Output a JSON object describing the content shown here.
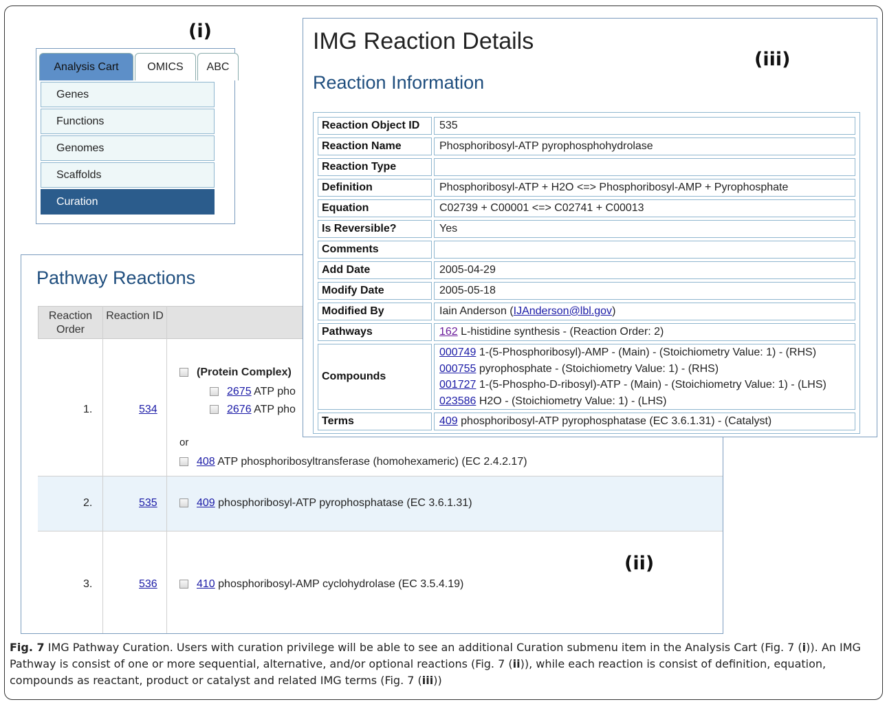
{
  "panel_labels": {
    "i": "(i)",
    "ii": "(ii)",
    "iii": "(iii)"
  },
  "menu": {
    "tabs": [
      "Analysis Cart",
      "OMICS",
      "ABC"
    ],
    "items": [
      "Genes",
      "Functions",
      "Genomes",
      "Scaffolds",
      "Curation"
    ],
    "active_item": "Curation"
  },
  "pathway": {
    "title": "Pathway Reactions",
    "headers": {
      "order": "Reaction Order",
      "id": "Reaction ID"
    },
    "rows": [
      {
        "order": "1.",
        "id": "534",
        "complex_label": "(Protein Complex)",
        "complex_items": [
          {
            "id": "2675",
            "text": "ATP pho"
          },
          {
            "id": "2676",
            "text": "ATP pho"
          }
        ],
        "or": "or",
        "alt": {
          "id": "408",
          "text": "ATP phosphoribosyltransferase (homohexameric) (EC 2.4.2.17)"
        }
      },
      {
        "order": "2.",
        "id": "535",
        "term": {
          "id": "409",
          "text": "phosphoribosyl-ATP pyrophosphatase (EC 3.6.1.31)"
        }
      },
      {
        "order": "3.",
        "id": "536",
        "term": {
          "id": "410",
          "text": "phosphoribosyl-AMP cyclohydrolase (EC 3.5.4.19)"
        }
      }
    ]
  },
  "details": {
    "title": "IMG Reaction Details",
    "subtitle": "Reaction Information",
    "rows": {
      "object_id": {
        "key": "Reaction Object ID",
        "value": "535"
      },
      "name": {
        "key": "Reaction Name",
        "value": "Phosphoribosyl-ATP pyrophosphohydrolase"
      },
      "type": {
        "key": "Reaction Type",
        "value": ""
      },
      "definition": {
        "key": "Definition",
        "value": "Phosphoribosyl-ATP + H2O <=> Phosphoribosyl-AMP + Pyrophosphate"
      },
      "equation": {
        "key": "Equation",
        "value": "C02739 + C00001 <=> C02741 + C00013"
      },
      "reversible": {
        "key": "Is Reversible?",
        "value": "Yes"
      },
      "comments": {
        "key": "Comments",
        "value": ""
      },
      "add_date": {
        "key": "Add Date",
        "value": "2005-04-29"
      },
      "modify_date": {
        "key": "Modify Date",
        "value": "2005-05-18"
      },
      "modified_by": {
        "key": "Modified By",
        "value_prefix": "Iain Anderson (",
        "email": "IJAnderson@lbl.gov",
        "value_suffix": ")"
      },
      "pathways": {
        "key": "Pathways",
        "link": "162",
        "value": "L-histidine synthesis - (Reaction Order: 2)"
      },
      "compounds": {
        "key": "Compounds",
        "items": [
          {
            "id": "000749",
            "text": "1-(5-Phosphoribosyl)-AMP - (Main) - (Stoichiometry Value: 1) - (RHS)"
          },
          {
            "id": "000755",
            "text": "pyrophosphate - (Stoichiometry Value: 1) - (RHS)"
          },
          {
            "id": "001727",
            "text": "1-(5-Phospho-D-ribosyl)-ATP - (Main) - (Stoichiometry Value: 1) - (LHS)"
          },
          {
            "id": "023586",
            "text": "H2O - (Stoichiometry Value: 1) - (LHS)"
          }
        ]
      },
      "terms": {
        "key": "Terms",
        "link": "409",
        "value": "phosphoribosyl-ATP pyrophosphatase (EC 3.6.1.31) - (Catalyst)"
      }
    }
  },
  "caption": {
    "label": "Fig. 7",
    "t1": " IMG Pathway Curation. Users with curation privilege will be able to see an additional Curation submenu item in the Analysis Cart (Fig. 7 (",
    "r1": "i",
    "t2": ")). An IMG Pathway is consist of one or more sequential, alternative, and/or optional reactions (Fig. 7 (",
    "r2": "ii",
    "t3": ")), while each reaction is consist of definition, equation, compounds as reactant, product or catalyst and related IMG terms (Fig. 7 (",
    "r3": "iii",
    "t4": "))"
  }
}
